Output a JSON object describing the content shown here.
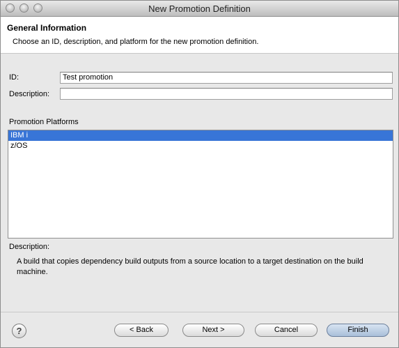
{
  "window": {
    "title": "New Promotion Definition"
  },
  "banner": {
    "title": "General Information",
    "message": "Choose an ID, description, and platform for the new promotion definition."
  },
  "form": {
    "id_label": "ID:",
    "id_value": "Test promotion",
    "description_label": "Description:",
    "description_value": "",
    "platforms_label": "Promotion Platforms",
    "platforms": [
      {
        "label": "IBM i",
        "selected": true
      },
      {
        "label": "z/OS",
        "selected": false
      }
    ],
    "platform_description_label": "Description:",
    "platform_description_text": "A build that copies dependency build outputs from a source location to a target destination on the build machine."
  },
  "buttons": {
    "help_icon": "question-mark-icon",
    "back": "< Back",
    "next": "Next >",
    "cancel": "Cancel",
    "finish": "Finish"
  },
  "colors": {
    "selection": "#3875d7",
    "window_bg": "#e8e8e8"
  }
}
